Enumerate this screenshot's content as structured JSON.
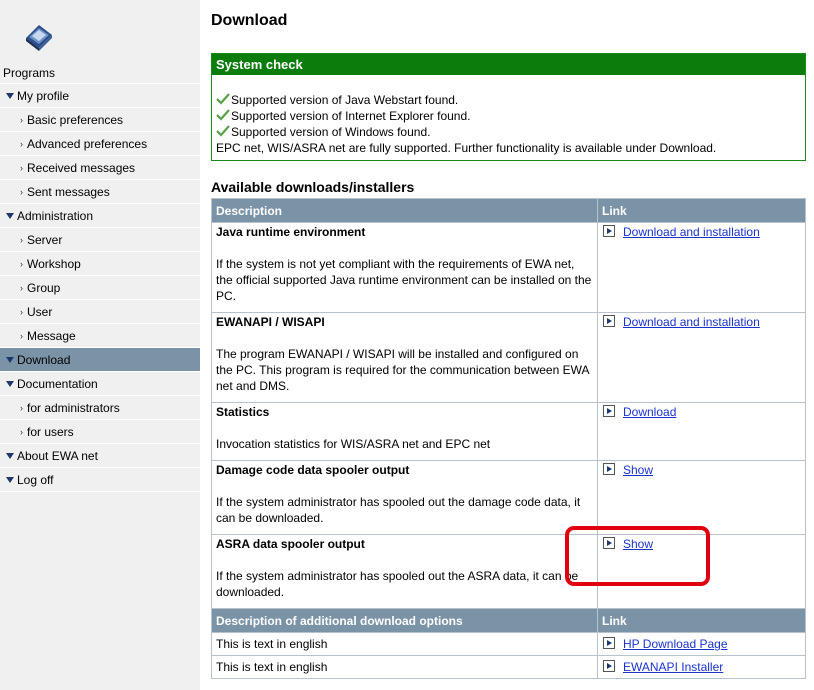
{
  "sidebar": {
    "section_title": "Programs",
    "items": [
      {
        "label": "My profile",
        "level": 1
      },
      {
        "label": "Basic preferences",
        "level": 2
      },
      {
        "label": "Advanced preferences",
        "level": 2
      },
      {
        "label": "Received messages",
        "level": 2
      },
      {
        "label": "Sent messages",
        "level": 2
      },
      {
        "label": "Administration",
        "level": 1
      },
      {
        "label": "Server",
        "level": 2
      },
      {
        "label": "Workshop",
        "level": 2
      },
      {
        "label": "Group",
        "level": 2
      },
      {
        "label": "User",
        "level": 2
      },
      {
        "label": "Message",
        "level": 2
      },
      {
        "label": "Download",
        "level": 1,
        "active": true
      },
      {
        "label": "Documentation",
        "level": 1
      },
      {
        "label": "for administrators",
        "level": 2
      },
      {
        "label": "for users",
        "level": 2
      },
      {
        "label": "About EWA net",
        "level": 1
      },
      {
        "label": "Log off",
        "level": 1
      }
    ]
  },
  "main": {
    "title": "Download",
    "system_check": {
      "header": "System check",
      "checks": [
        "Supported version of Java Webstart found.",
        "Supported version of Internet Explorer found.",
        "Supported version of Windows found."
      ],
      "summary": "EPC net, WIS/ASRA net are fully supported. Further functionality is available under Download."
    },
    "downloads": {
      "heading": "Available downloads/installers",
      "col_description": "Description",
      "col_link": "Link",
      "rows": [
        {
          "title": "Java runtime environment",
          "text": "If the system is not yet compliant with the requirements of EWA net, the official supported Java runtime environment can be installed on the PC.",
          "link": "Download and installation"
        },
        {
          "title": "EWANAPI / WISAPI",
          "text": "The program EWANAPI / WISAPI will be installed and configured on the PC. This program is required for the communication between EWA net and DMS.",
          "link": "Download and installation"
        },
        {
          "title": "Statistics",
          "text": "Invocation statistics for WIS/ASRA net and EPC net",
          "link": "Download"
        },
        {
          "title": "Damage code data spooler output",
          "text": "If the system administrator has spooled out the damage code data, it can be downloaded.",
          "link": "Show"
        },
        {
          "title": "ASRA data spooler output",
          "text": "If the system administrator has spooled out the ASRA data, it can be downloaded.",
          "link": "Show"
        }
      ],
      "additional_header": "Description of additional download options",
      "additional_link_header": "Link",
      "additional_rows": [
        {
          "text": "This is text in english",
          "link": "HP Download Page"
        },
        {
          "text": "This is text in english",
          "link": "EWANAPI Installer"
        }
      ]
    }
  },
  "colors": {
    "nav_active": "#7b93a6",
    "check_border": "#0c7d0c",
    "highlight": "#e00010",
    "link": "#1a33cc"
  }
}
